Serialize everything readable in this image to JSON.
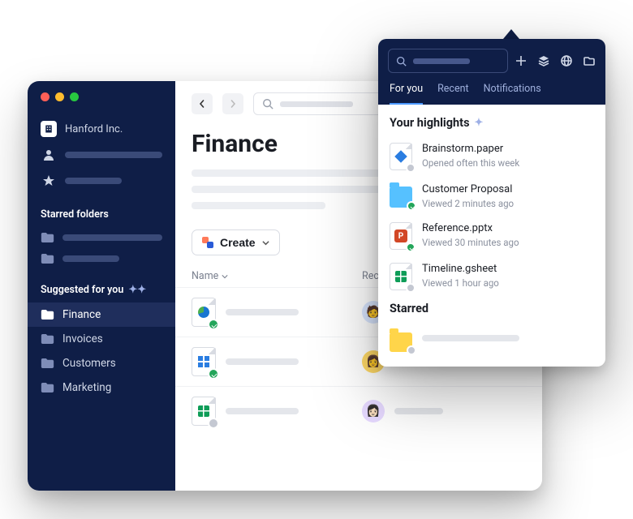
{
  "sidebar": {
    "org_name": "Hanford Inc.",
    "starred_heading": "Starred folders",
    "suggested_heading": "Suggested for you",
    "items": [
      {
        "label": "Finance",
        "active": true
      },
      {
        "label": "Invoices",
        "active": false
      },
      {
        "label": "Customers",
        "active": false
      },
      {
        "label": "Marketing",
        "active": false
      }
    ]
  },
  "main": {
    "title": "Finance",
    "create_label": "Create",
    "columns": {
      "name": "Name",
      "recent": "Recent"
    }
  },
  "popover": {
    "tabs": [
      {
        "label": "For you",
        "active": true
      },
      {
        "label": "Recent",
        "active": false
      },
      {
        "label": "Notifications",
        "active": false
      }
    ],
    "highlights_heading": "Your highlights",
    "starred_heading": "Starred",
    "items": [
      {
        "title": "Brainstorm.paper",
        "sub": "Opened often this week",
        "kind": "paper",
        "badge": "grey"
      },
      {
        "title": "Customer Proposal",
        "sub": "Viewed 2 minutes ago",
        "kind": "folder",
        "badge": "green"
      },
      {
        "title": "Reference.pptx",
        "sub": "Viewed 30 minutes ago",
        "kind": "ppt",
        "badge": "green"
      },
      {
        "title": "Timeline.gsheet",
        "sub": "Viewed 1 hour ago",
        "kind": "sheet",
        "badge": "grey"
      }
    ]
  }
}
